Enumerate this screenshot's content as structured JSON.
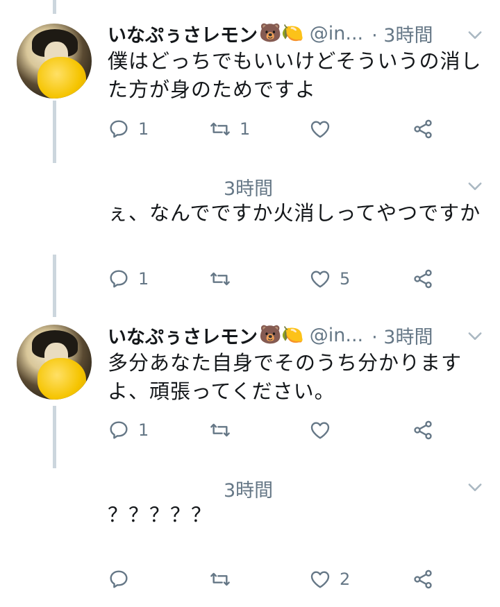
{
  "tweets": [
    {
      "name": "いなぷぅさレモン",
      "emoji": "🐻🍋",
      "handle": "@in...",
      "time": "· 3時間",
      "lines": [
        "僕はどっちでもいいけどそういうの消し",
        "た方が身のためですよ"
      ],
      "replies": "1",
      "retweets": "1",
      "likes": ""
    },
    {
      "time": "3時間",
      "lines": [
        "ぇ、なんでですか火消しってやつですか"
      ],
      "replies": "1",
      "retweets": "",
      "likes": "5"
    },
    {
      "name": "いなぷぅさレモン",
      "emoji": "🐻🍋",
      "handle": "@in...",
      "time": "· 3時間",
      "lines": [
        "多分あなた自身でそのうち分かります",
        "よ、頑張ってください。"
      ],
      "replies": "1",
      "retweets": "",
      "likes": ""
    },
    {
      "time": "3時間",
      "lines": [
        "？？？？？"
      ],
      "replies": "",
      "retweets": "",
      "likes": "2"
    }
  ],
  "colors": {
    "text": "#14171a",
    "muted": "#657786",
    "thread_line": "#ccd6dd"
  },
  "icons": [
    "reply-icon",
    "retweet-icon",
    "like-icon",
    "share-icon",
    "caret-down-icon"
  ]
}
